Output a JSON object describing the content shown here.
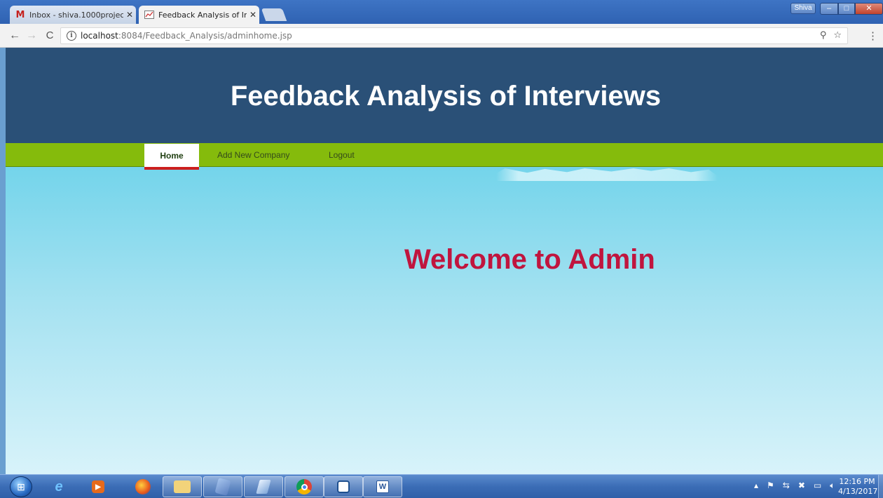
{
  "browser": {
    "tabs": [
      {
        "title": "Inbox - shiva.1000projec",
        "favicon": "gmail-icon",
        "active": false
      },
      {
        "title": "Feedback Analysis of Inte",
        "favicon": "page-icon",
        "active": true
      }
    ],
    "profile": "Shiva",
    "address": {
      "host": "localhost",
      "path": ":8084/Feedback_Analysis/adminhome.jsp"
    }
  },
  "site": {
    "title": "Feedback Analysis of Interviews",
    "nav": {
      "home": "Home",
      "add_company": "Add New Company",
      "logout": "Logout"
    },
    "welcome": "Welcome to Admin"
  },
  "taskbar": {
    "time": "12:16 PM",
    "date": "4/13/2017"
  },
  "colors": {
    "header": "#2a5077",
    "nav": "#85bb0c",
    "welcome": "#c0153e",
    "active_tab_underline": "#cc1f1f"
  }
}
